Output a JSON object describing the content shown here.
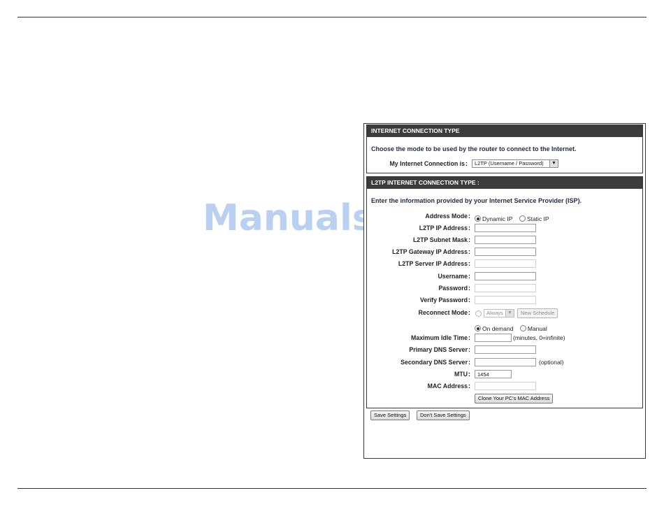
{
  "connection_type": {
    "header": "INTERNET CONNECTION TYPE",
    "description": "Choose the mode to be used by the router to connect to the Internet.",
    "label": "My Internet Connection is",
    "selected": "L2TP (Username / Password)"
  },
  "l2tp": {
    "header": "L2TP INTERNET CONNECTION TYPE :",
    "description": "Enter the information provided by your Internet Service Provider (ISP).",
    "address_mode": {
      "label": "Address Mode",
      "options": [
        "Dynamic IP",
        "Static IP"
      ],
      "selected": "Dynamic IP"
    },
    "fields": {
      "ip_address": {
        "label": "L2TP IP Address",
        "value": ""
      },
      "subnet_mask": {
        "label": "L2TP Subnet Mask",
        "value": ""
      },
      "gateway_ip": {
        "label": "L2TP Gateway IP Address",
        "value": ""
      },
      "server_ip": {
        "label": "L2TP Server IP Address",
        "value": ""
      },
      "username": {
        "label": "Username",
        "value": ""
      },
      "password": {
        "label": "Password",
        "value": ""
      },
      "verify_password": {
        "label": "Verify Password",
        "value": ""
      },
      "max_idle_time": {
        "label": "Maximum Idle Time",
        "value": "",
        "note": "(minutes, 0=infinite)"
      },
      "primary_dns": {
        "label": "Primary DNS Server",
        "value": ""
      },
      "secondary_dns": {
        "label": "Secondary DNS Server",
        "value": "",
        "note": "(optional)"
      },
      "mtu": {
        "label": "MTU",
        "value": "1454"
      },
      "mac_address": {
        "label": "MAC Address",
        "value": ""
      }
    },
    "reconnect": {
      "label": "Reconnect Mode",
      "schedule_select": "Always",
      "new_schedule_button": "New Schedule",
      "option_on_demand": "On demand",
      "option_manual": "Manual",
      "selected": "On demand"
    },
    "clone_mac_button": "Clone Your PC's MAC Address"
  },
  "actions": {
    "save": "Save Settings",
    "dont_save": "Don't Save Settings"
  },
  "watermark": "ManualsLib.de"
}
